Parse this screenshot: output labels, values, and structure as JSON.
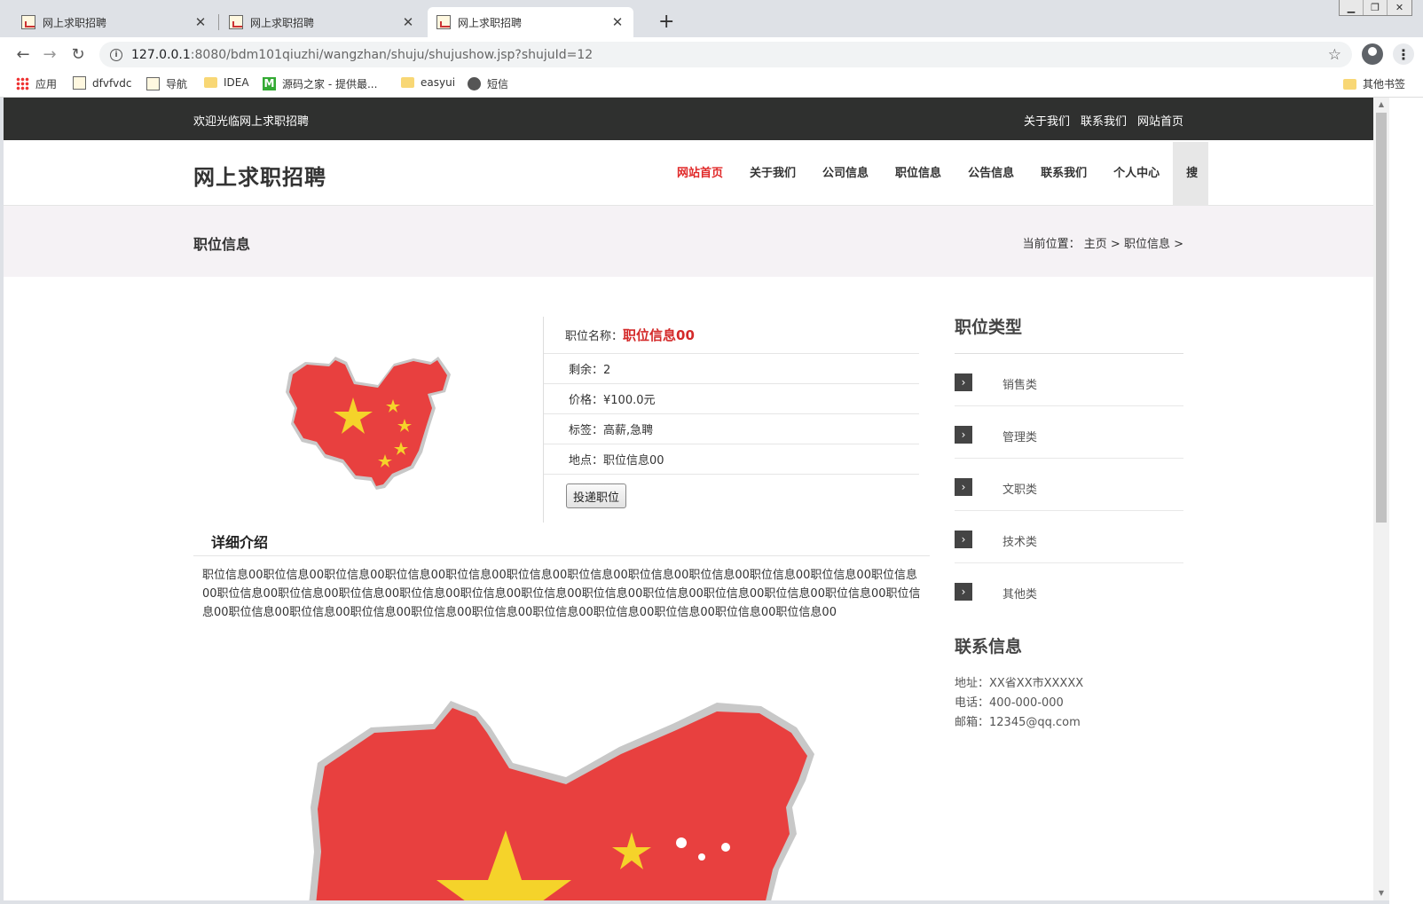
{
  "browser": {
    "tabs": [
      {
        "title": "网上求职招聘",
        "active": false
      },
      {
        "title": "网上求职招聘",
        "active": false
      },
      {
        "title": "网上求职招聘",
        "active": true
      }
    ],
    "url_host": "127.0.0.1",
    "url_rest": ":8080/bdm101qiuzhi/wangzhan/shuju/shujushow.jsp?shujuId=12",
    "bookmarks": [
      "应用",
      "dfvfvdc",
      "导航",
      "IDEA",
      "源码之家 - 提供最...",
      "easyui",
      "短信"
    ],
    "other_bookmarks": "其他书签"
  },
  "topbar": {
    "welcome": "欢迎光临网上求职招聘",
    "links": [
      "关于我们",
      "联系我们",
      "网站首页"
    ]
  },
  "header": {
    "site_title": "网上求职招聘",
    "nav": [
      "网站首页",
      "关于我们",
      "公司信息",
      "职位信息",
      "公告信息",
      "联系我们",
      "个人中心"
    ],
    "active_nav": "网站首页",
    "search_label": "搜"
  },
  "pagehead": {
    "title": "职位信息",
    "breadcrumb": "当前位置： 主页 > 职位信息 >"
  },
  "job": {
    "name_label": "职位名称：",
    "name": "职位信息00",
    "remaining": "剩余：2",
    "price": "价格：¥100.0元",
    "tags": "标签：高薪,急聘",
    "location": "地点：职位信息00",
    "apply_button": "投递职位"
  },
  "intro": {
    "title": "详细介绍",
    "text": "职位信息00职位信息00职位信息00职位信息00职位信息00职位信息00职位信息00职位信息00职位信息00职位信息00职位信息00职位信息00职位信息00职位信息00职位信息00职位信息00职位信息00职位信息00职位信息00职位信息00职位信息00职位信息00职位信息00职位信息00职位信息00职位信息00职位信息00职位信息00职位信息00职位信息00职位信息00职位信息00职位信息00职位信息00"
  },
  "sidebar": {
    "category_title": "职位类型",
    "categories": [
      "销售类",
      "管理类",
      "文职类",
      "技术类",
      "其他类"
    ],
    "contact_title": "联系信息",
    "address": "地址：XX省XX市XXXXX",
    "phone": "电话：400-000-000",
    "email": "邮箱：12345@qq.com"
  },
  "colors": {
    "topbar_bg": "#2f302f",
    "accent_red": "#e02828",
    "pagehead_bg": "#f5f2f5",
    "map_red": "#e8403f",
    "star_yellow": "#f5d32a"
  },
  "icons": [
    "favicon-icon",
    "close-icon",
    "plus-icon",
    "back-icon",
    "forward-icon",
    "reload-icon",
    "info-icon",
    "star-icon",
    "profile-icon",
    "menu-icon",
    "apps-icon",
    "folder-icon",
    "globe-icon",
    "chevron-right-icon",
    "china-map-image"
  ]
}
